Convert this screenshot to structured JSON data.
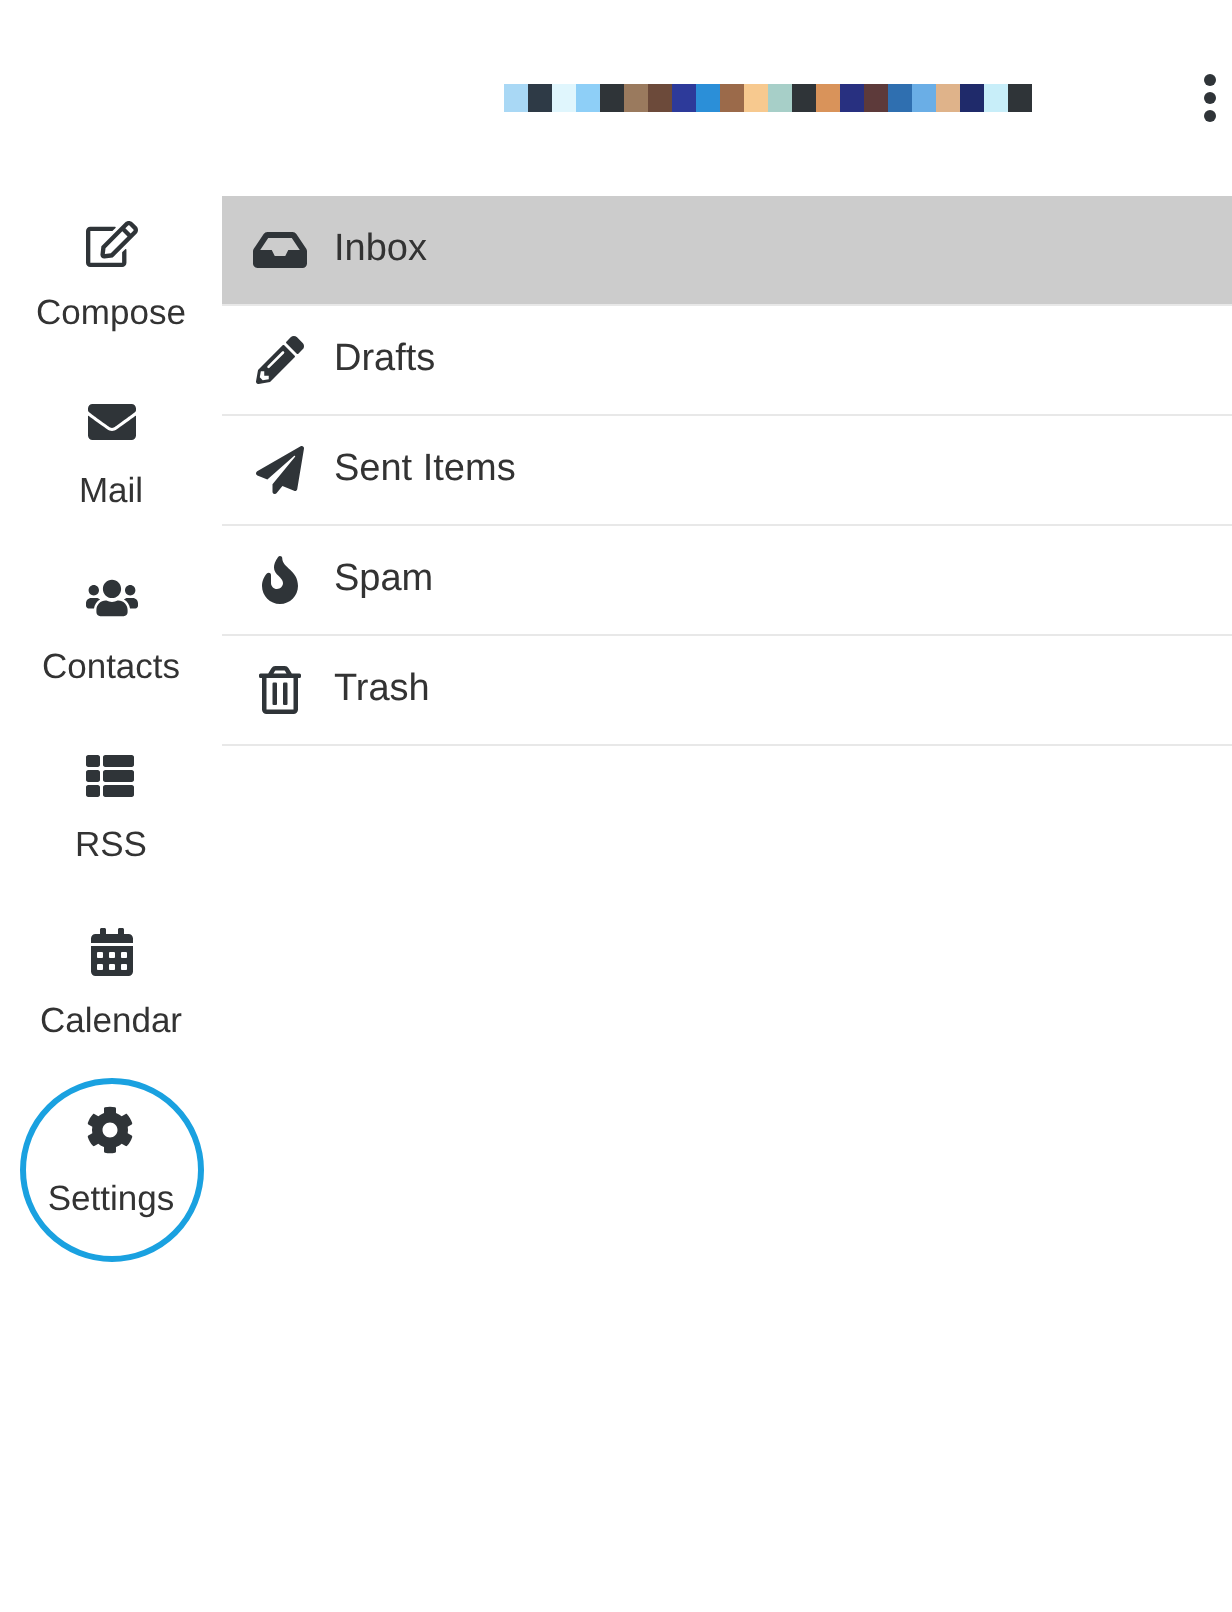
{
  "nav": [
    {
      "label": "Compose",
      "highlighted": false
    },
    {
      "label": "Mail",
      "highlighted": false
    },
    {
      "label": "Contacts",
      "highlighted": false
    },
    {
      "label": "RSS",
      "highlighted": false
    },
    {
      "label": "Calendar",
      "highlighted": false
    },
    {
      "label": "Settings",
      "highlighted": true
    }
  ],
  "folders": [
    {
      "label": "Inbox",
      "selected": true
    },
    {
      "label": "Drafts",
      "selected": false
    },
    {
      "label": "Sent Items",
      "selected": false
    },
    {
      "label": "Spam",
      "selected": false
    },
    {
      "label": "Trash",
      "selected": false
    }
  ]
}
